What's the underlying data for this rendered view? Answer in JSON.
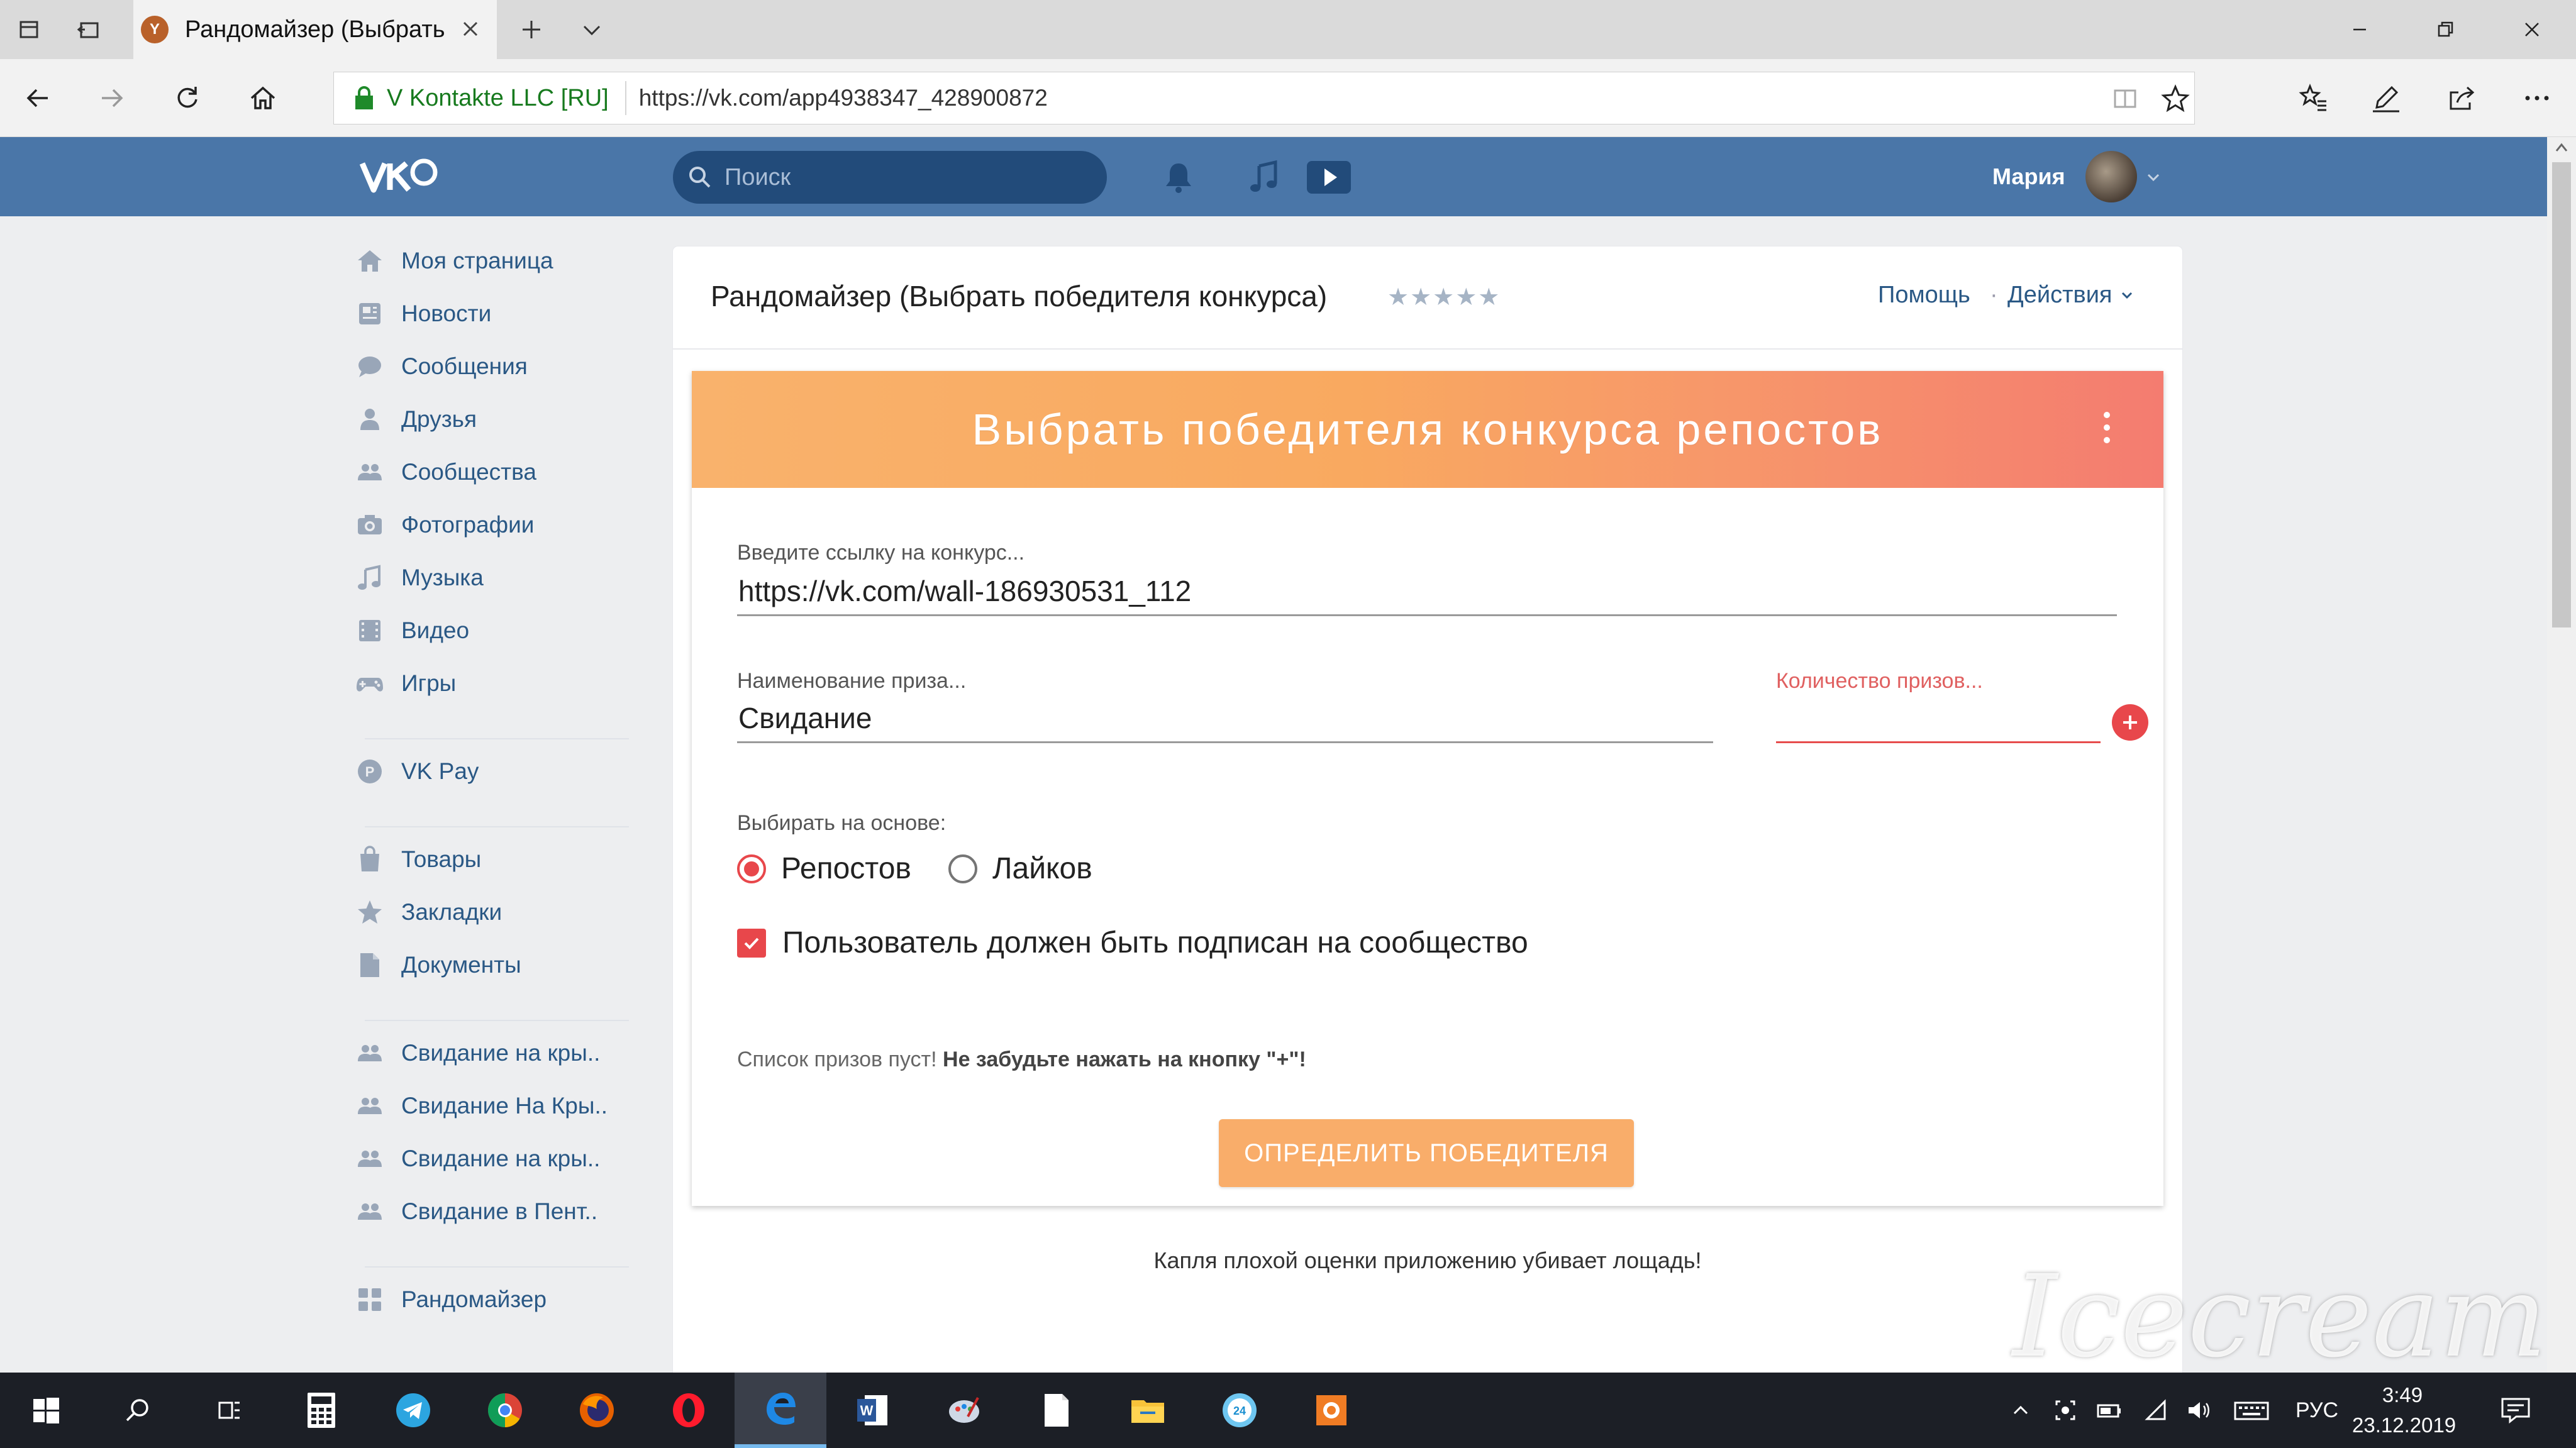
{
  "browser": {
    "tab_title": "Рандомайзер (Выбрать",
    "cert_label": "V Kontakte LLC [RU]",
    "url": "https://vk.com/app4938347_428900872"
  },
  "vk_header": {
    "logo": "vk",
    "search_placeholder": "Поиск",
    "user_name": "Мария"
  },
  "sidebar": {
    "items": [
      {
        "label": "Моя страница",
        "icon": "home-icon"
      },
      {
        "label": "Новости",
        "icon": "news-icon"
      },
      {
        "label": "Сообщения",
        "icon": "messages-icon"
      },
      {
        "label": "Друзья",
        "icon": "friends-icon"
      },
      {
        "label": "Сообщества",
        "icon": "groups-icon"
      },
      {
        "label": "Фотографии",
        "icon": "camera-icon"
      },
      {
        "label": "Музыка",
        "icon": "music-icon"
      },
      {
        "label": "Видео",
        "icon": "video-icon"
      },
      {
        "label": "Игры",
        "icon": "gamepad-icon"
      },
      {
        "label": "VK Pay",
        "icon": "vkpay-icon"
      },
      {
        "label": "Товары",
        "icon": "bag-icon"
      },
      {
        "label": "Закладки",
        "icon": "star-icon"
      },
      {
        "label": "Документы",
        "icon": "document-icon"
      },
      {
        "label": "Свидание на кры..",
        "icon": "group-icon"
      },
      {
        "label": "Свидание На Кры..",
        "icon": "group-icon"
      },
      {
        "label": "Свидание на кры..",
        "icon": "group-icon"
      },
      {
        "label": "Свидание в Пент..",
        "icon": "group-icon"
      },
      {
        "label": "Рандомайзер",
        "icon": "apps-icon"
      }
    ]
  },
  "app": {
    "title": "Рандомайзер (Выбрать победителя конкурса)",
    "stars": "★★★★★",
    "help": "Помощь",
    "separator": "·",
    "actions": "Действия",
    "banner_title": "Выбрать победителя конкурса репостов",
    "link_label": "Введите ссылку на конкурс...",
    "link_value": "https://vk.com/wall-186930531_112",
    "prize_label": "Наименование приза...",
    "prize_value": "Свидание",
    "count_label": "Количество призов...",
    "count_value": "",
    "basis_label": "Выбирать на основе:",
    "radio_reposts": "Репостов",
    "radio_likes": "Лайков",
    "basis_selected": "Репостов",
    "subscribe_label": "Пользователь должен быть подписан на сообщество",
    "subscribe_checked": true,
    "empty_note": "Список призов пуст!",
    "empty_hint": "Не забудьте нажать на кнопку \"+\"!",
    "submit_label": "ОПРЕДЕЛИТЬ ПОБЕДИТЕЛЯ",
    "footer_text": "Капля плохой оценки приложению убивает лощадь!"
  },
  "watermark": "Icecream",
  "taskbar": {
    "apps": [
      "start",
      "search",
      "task-view",
      "calculator",
      "telegram",
      "chrome",
      "firefox",
      "opera",
      "edge",
      "word",
      "paint",
      "notepad",
      "explorer",
      "app-24",
      "photo-app"
    ],
    "language": "РУС",
    "time": "3:49",
    "date": "23.12.2019"
  },
  "colors": {
    "vk_blue": "#4a76a8",
    "accent_red": "#e8474b",
    "button_orange": "#f9ad6a"
  }
}
